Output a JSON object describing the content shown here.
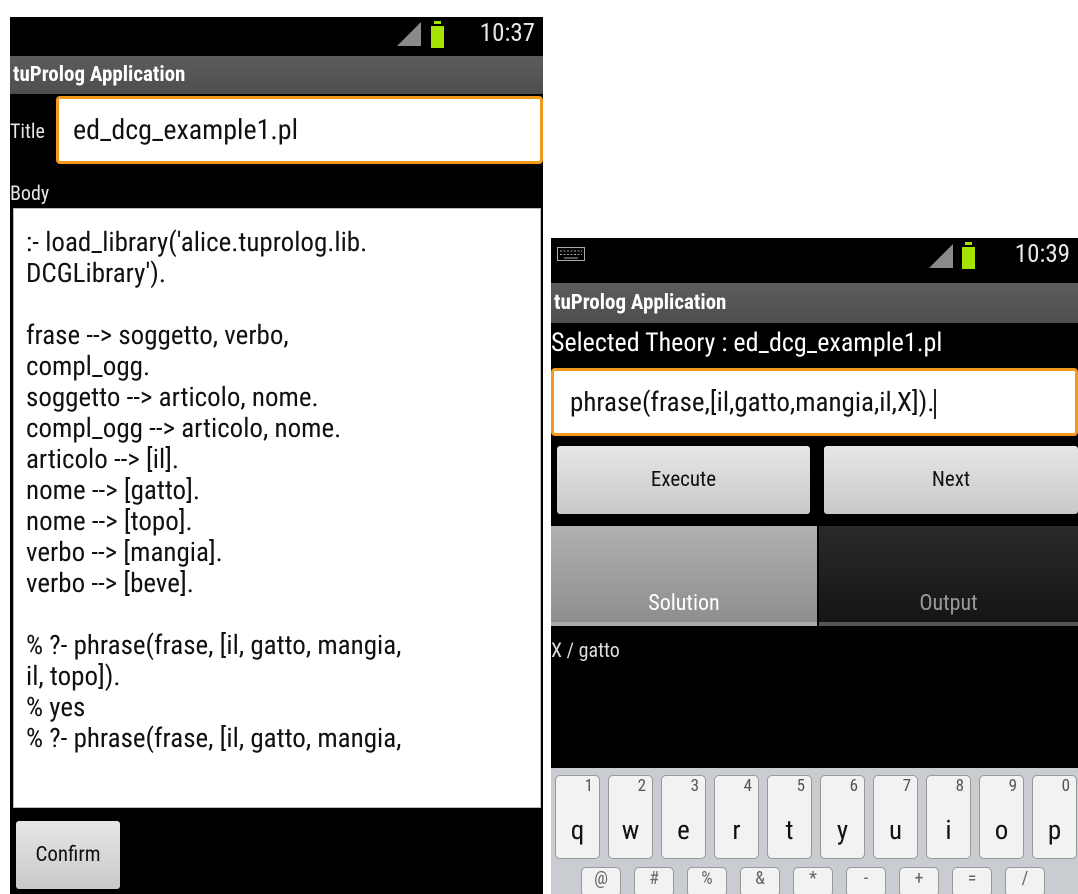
{
  "left": {
    "status": {
      "time": "10:37"
    },
    "app_title": "tuProlog Application",
    "title_label": "Title",
    "title_value": "ed_dcg_example1.pl",
    "body_label": "Body",
    "body_text": ":- load_library('alice.tuprolog.lib.\nDCGLibrary').\n\nfrase --> soggetto, verbo,\ncompl_ogg.\nsoggetto --> articolo, nome.\ncompl_ogg --> articolo, nome.\narticolo --> [il].\nnome --> [gatto].\nnome --> [topo].\nverbo --> [mangia].\nverbo --> [beve].\n\n% ?- phrase(frase, [il, gatto, mangia,\nil, topo]).\n% yes\n% ?- phrase(frase, [il, gatto, mangia,",
    "confirm_label": "Confirm"
  },
  "right": {
    "status": {
      "time": "10:39"
    },
    "app_title": "tuProlog Application",
    "selected_theory": "Selected Theory : ed_dcg_example1.pl",
    "query": "phrase(frase,[il,gatto,mangia,il,X]).",
    "execute_label": "Execute",
    "next_label": "Next",
    "tabs": {
      "solution": "Solution",
      "output": "Output"
    },
    "result": "X / gatto",
    "keyboard": {
      "row1": [
        {
          "main": "q",
          "sub": "1"
        },
        {
          "main": "w",
          "sub": "2"
        },
        {
          "main": "e",
          "sub": "3"
        },
        {
          "main": "r",
          "sub": "4"
        },
        {
          "main": "t",
          "sub": "5"
        },
        {
          "main": "y",
          "sub": "6"
        },
        {
          "main": "u",
          "sub": "7"
        },
        {
          "main": "i",
          "sub": "8"
        },
        {
          "main": "o",
          "sub": "9"
        },
        {
          "main": "p",
          "sub": "0"
        }
      ],
      "row2": [
        "@",
        "#",
        "%",
        "&",
        "*",
        "-",
        "+",
        "=",
        "/"
      ]
    }
  }
}
